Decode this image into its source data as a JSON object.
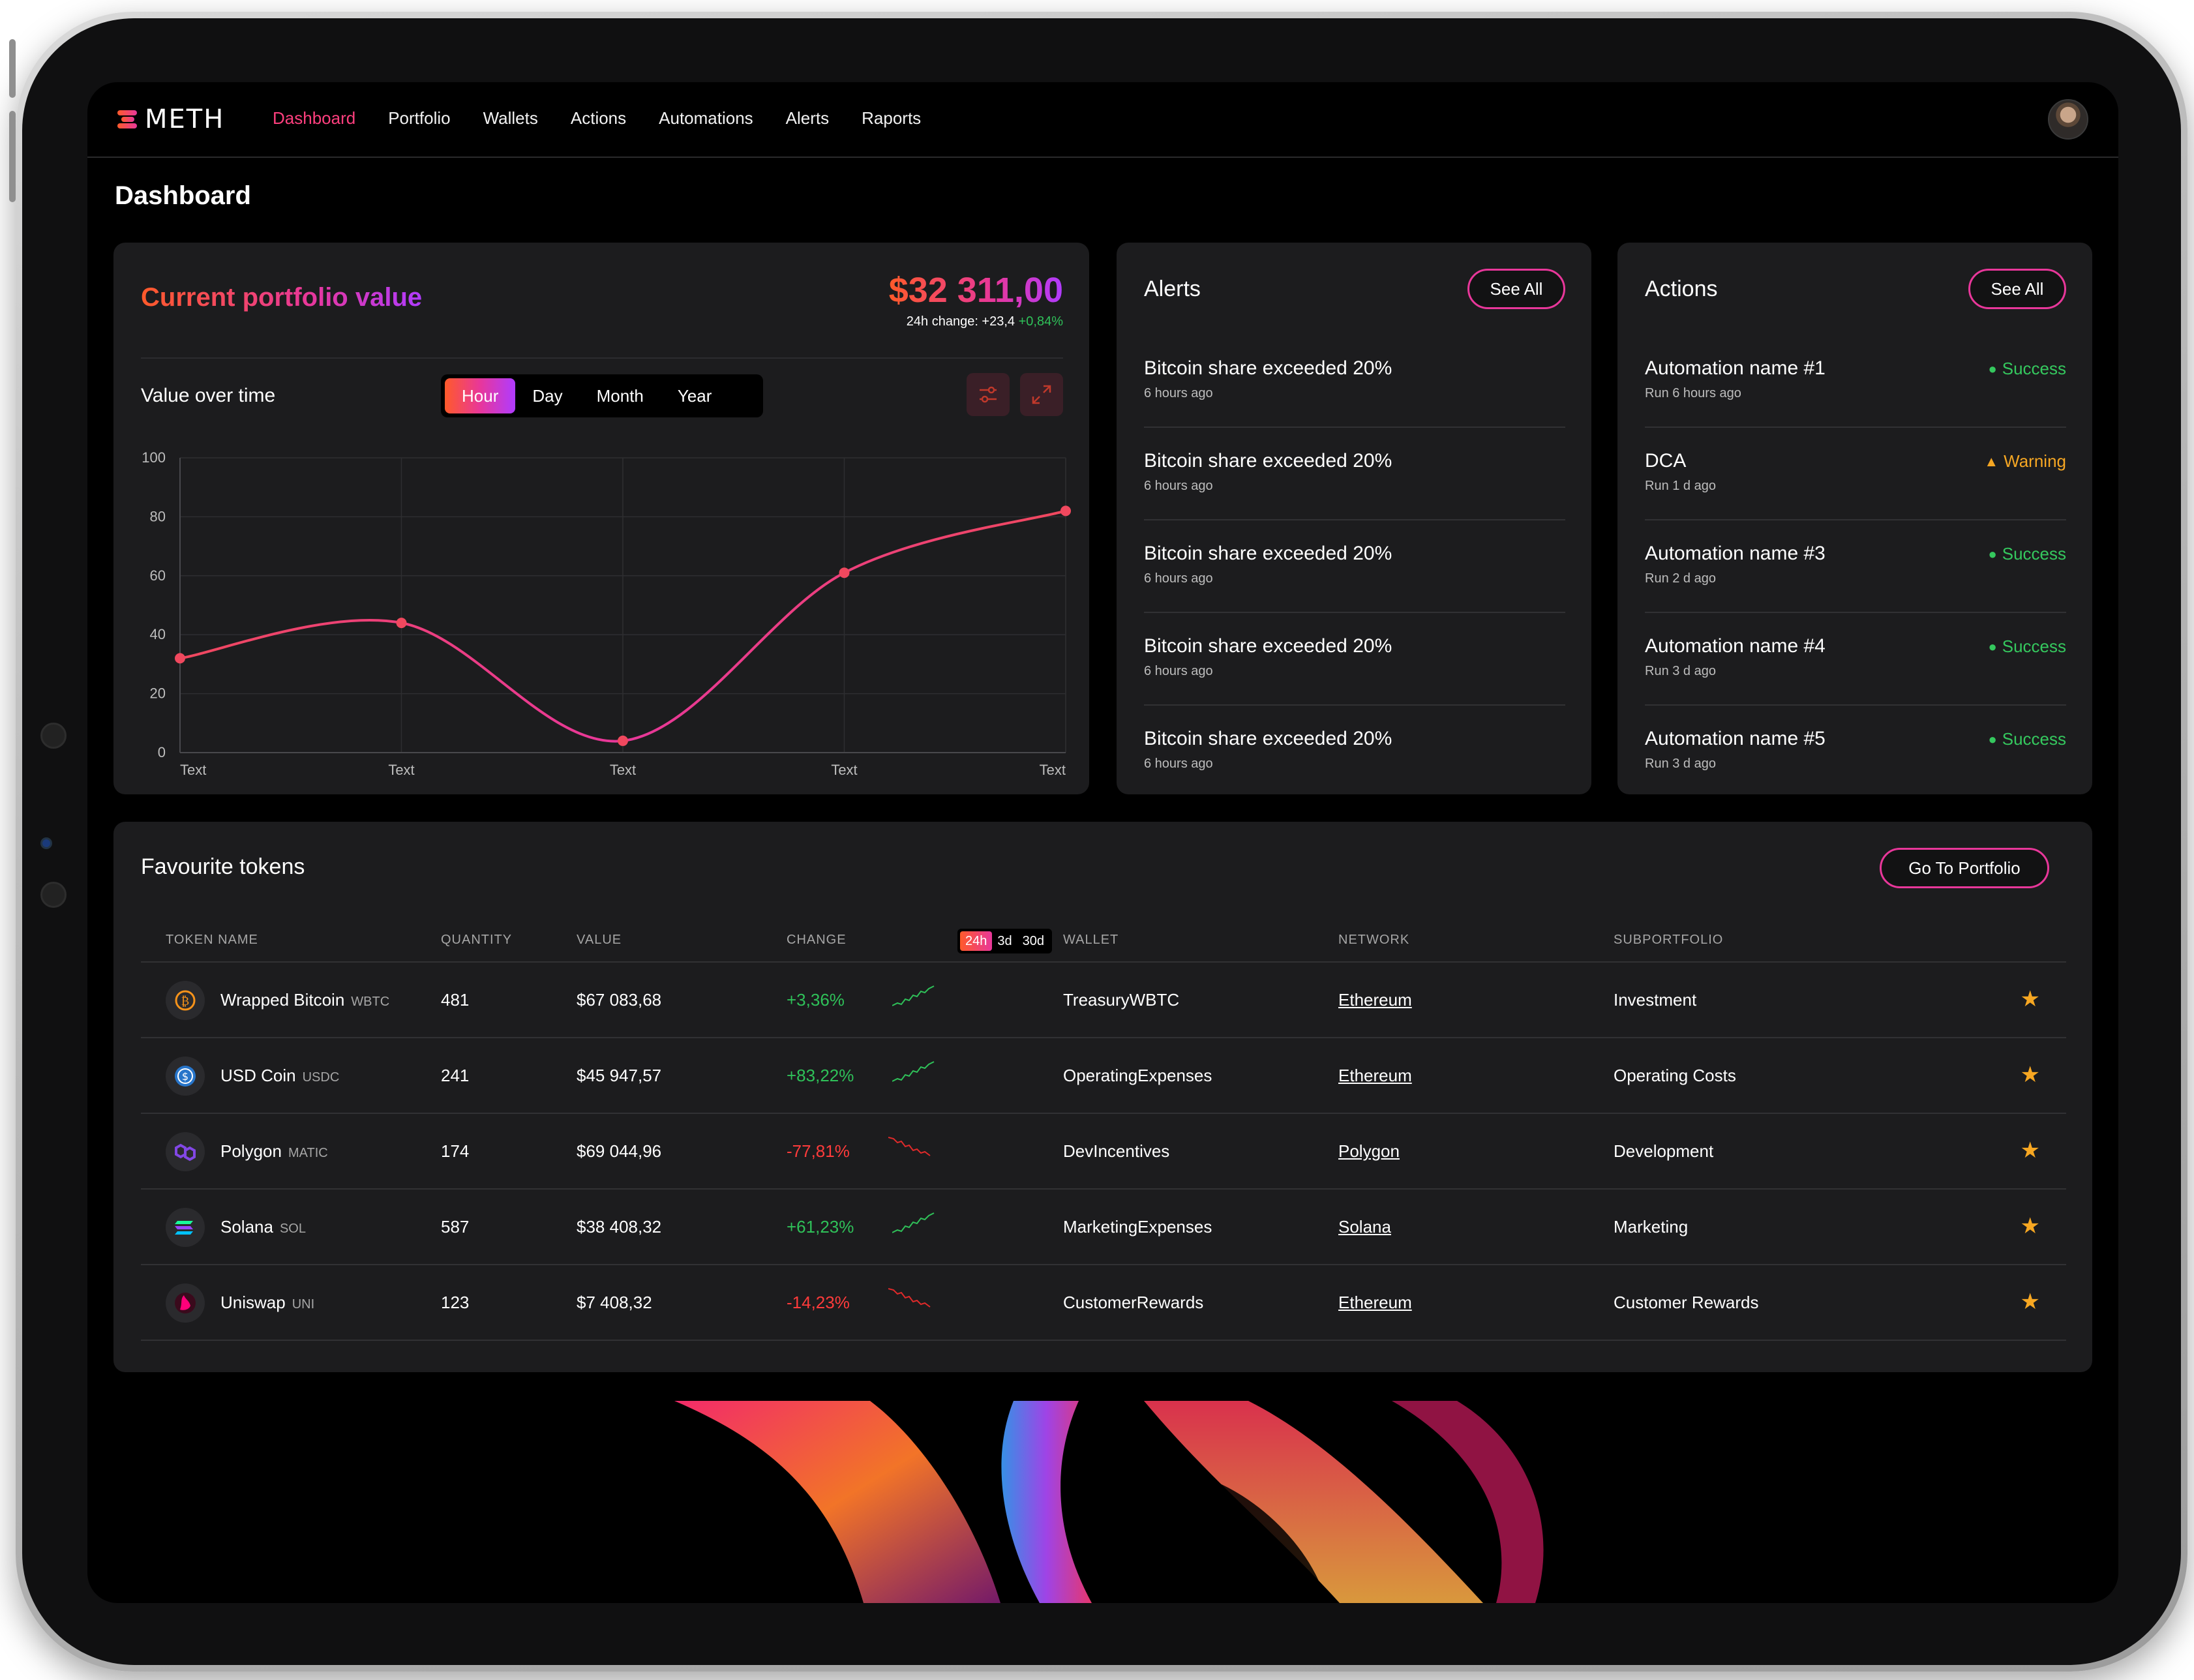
{
  "app": {
    "logo": "METH"
  },
  "nav": {
    "items": [
      "Dashboard",
      "Portfolio",
      "Wallets",
      "Actions",
      "Automations",
      "Alerts",
      "Raports"
    ],
    "active": "Dashboard"
  },
  "page": {
    "title": "Dashboard"
  },
  "portfolio": {
    "title": "Current portfolio value",
    "value": "$32 311,00",
    "change_label": "24h change: +23,4",
    "change_pct": "+0,84%",
    "chart_title": "Value over time",
    "ranges": [
      "Hour",
      "Day",
      "Month",
      "Year"
    ],
    "active_range": "Hour",
    "icons": [
      "filter-icon",
      "expand-icon"
    ]
  },
  "chart_data": {
    "type": "line",
    "categories": [
      "Text",
      "Text",
      "Text",
      "Text",
      "Text"
    ],
    "x": [
      0,
      1,
      2,
      3,
      4
    ],
    "values": [
      32,
      44,
      4,
      61,
      82
    ],
    "ylim": [
      0,
      100
    ],
    "yticks": [
      "100",
      "80",
      "60",
      "40",
      "20",
      "0"
    ],
    "grid": true,
    "colors": [
      "#f0485e",
      "#e8379a",
      "#f0485e"
    ]
  },
  "alerts": {
    "title": "Alerts",
    "see_all": "See All",
    "items": [
      {
        "title": "Bitcoin share exceeded 20%",
        "time": "6 hours ago"
      },
      {
        "title": "Bitcoin share exceeded 20%",
        "time": "6 hours ago"
      },
      {
        "title": "Bitcoin share exceeded 20%",
        "time": "6 hours ago"
      },
      {
        "title": "Bitcoin share exceeded 20%",
        "time": "6 hours ago"
      },
      {
        "title": "Bitcoin share exceeded 20%",
        "time": "6 hours ago"
      }
    ]
  },
  "actions": {
    "title": "Actions",
    "see_all": "See All",
    "items": [
      {
        "title": "Automation name #1",
        "time": "Run 6 hours ago",
        "status": "Success"
      },
      {
        "title": "DCA",
        "time": "Run 1 d ago",
        "status": "Warning"
      },
      {
        "title": "Automation name #3",
        "time": "Run 2 d ago",
        "status": "Success"
      },
      {
        "title": "Automation name #4",
        "time": "Run 3 d ago",
        "status": "Success"
      },
      {
        "title": "Automation name #5",
        "time": "Run 3 d ago",
        "status": "Success"
      }
    ]
  },
  "tokens": {
    "title": "Favourite tokens",
    "go_button": "Go To Portfolio",
    "headers": [
      "TOKEN NAME",
      "QUANTITY",
      "VALUE",
      "CHANGE",
      "WALLET",
      "NETWORK",
      "SUBPORTFOLIO"
    ],
    "change_ranges": [
      "24h",
      "3d",
      "30d"
    ],
    "active_change_range": "24h",
    "rows": [
      {
        "name": "Wrapped Bitcoin",
        "symbol": "WBTC",
        "icon": "bitcoin-icon",
        "quantity": "481",
        "value": "$67 083,68",
        "change": "+3,36%",
        "trend": "up",
        "wallet": "TreasuryWBTC",
        "network": "Ethereum",
        "subportfolio": "Investment",
        "favourite": true
      },
      {
        "name": "USD Coin",
        "symbol": "USDC",
        "icon": "usdc-icon",
        "quantity": "241",
        "value": "$45 947,57",
        "change": "+83,22%",
        "trend": "up",
        "wallet": "OperatingExpenses",
        "network": "Ethereum",
        "subportfolio": "Operating Costs",
        "favourite": true
      },
      {
        "name": "Polygon",
        "symbol": "MATIC",
        "icon": "polygon-icon",
        "quantity": "174",
        "value": "$69 044,96",
        "change": "-77,81%",
        "trend": "down",
        "wallet": "DevIncentives",
        "network": "Polygon",
        "subportfolio": "Development",
        "favourite": true
      },
      {
        "name": "Solana",
        "symbol": "SOL",
        "icon": "solana-icon",
        "quantity": "587",
        "value": "$38 408,32",
        "change": "+61,23%",
        "trend": "up",
        "wallet": "MarketingExpenses",
        "network": "Solana",
        "subportfolio": "Marketing",
        "favourite": true
      },
      {
        "name": "Uniswap",
        "symbol": "UNI",
        "icon": "uniswap-icon",
        "quantity": "123",
        "value": "$7 408,32",
        "change": "-14,23%",
        "trend": "down",
        "wallet": "CustomerRewards",
        "network": "Ethereum",
        "subportfolio": "Customer Rewards",
        "favourite": true
      }
    ]
  }
}
